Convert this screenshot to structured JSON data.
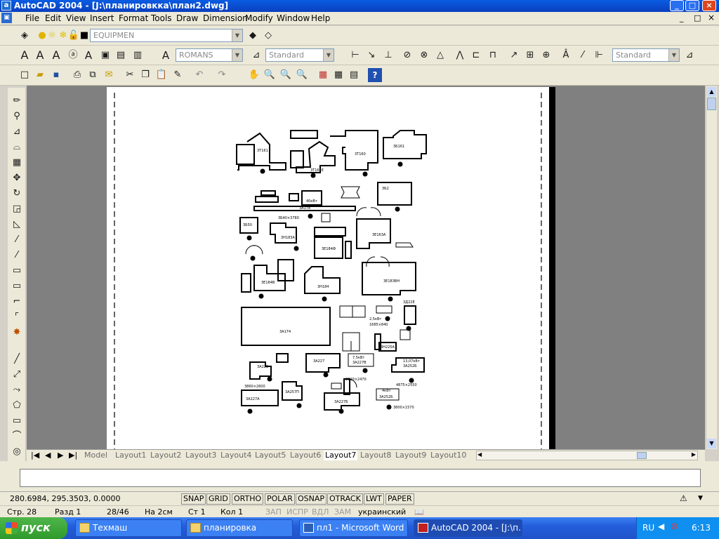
{
  "window": {
    "title": "AutoCAD 2004 - [J:\\планировкка\\план2.dwg]",
    "controls": [
      "_",
      "□",
      "×"
    ],
    "doc_controls": [
      "_",
      "□",
      "×"
    ]
  },
  "menu": [
    "File",
    "Edit",
    "View",
    "Insert",
    "Format",
    "Tools",
    "Draw",
    "Dimension",
    "Modify",
    "Window",
    "Help"
  ],
  "layers_toolbar": {
    "layer_value": "EQUIPMEN"
  },
  "styles_toolbar": {
    "text_style": "ROMANS",
    "dim_style": "Standard",
    "table_style": "Standard"
  },
  "tabs": {
    "items": [
      "Model",
      "Layout1",
      "Layout2",
      "Layout3",
      "Layout4",
      "Layout5",
      "Layout6",
      "Layout7",
      "Layout8",
      "Layout9",
      "Layout10"
    ],
    "active": "Layout7"
  },
  "status": {
    "coords": "280.6984, 295.3503, 0.0000",
    "buttons": [
      "SNAP",
      "GRID",
      "ORTHO",
      "POLAR",
      "OSNAP",
      "OTRACK",
      "LWT",
      "PAPER"
    ]
  },
  "word_status": {
    "page": "Стр. 28",
    "section": "Разд 1",
    "pages": "28/46",
    "at": "На 2см",
    "line": "Ст 1",
    "col": "Кол 1",
    "modes": [
      "ЗАП",
      "ИСПР",
      "ВДЛ",
      "ЗАМ"
    ],
    "language": "украинский"
  },
  "taskbar": {
    "start": "пуск",
    "tasks": [
      "Техмаш",
      "планировка",
      "пл1 - Microsoft Word",
      "AutoCAD 2004 - [J:\\п..."
    ],
    "lang": "RU",
    "clock": "6:13"
  },
  "drawing_labels": {
    "m1": "3Т161",
    "m2": "3Т161Е",
    "m3": "3Т160",
    "m4": "3Б161",
    "m5": "3Б2",
    "m6": "40кВт",
    "m7": "3А178",
    "m8": "3Б50",
    "m9": "3Б40×3780",
    "m10": "3Н183А",
    "m11": "3Е184В",
    "m12": "3Е163А",
    "m13": "3Е184Ф",
    "m14": "3Н184",
    "m15": "3Е183ВН",
    "m16": "3А174",
    "m17": "3Д22Е",
    "m18": "2,5кВт",
    "m19": "1685×840",
    "m20": "3Н225А",
    "m21": "3А228",
    "m22": "3А227",
    "m23": "7,5кВт",
    "m24": "3А227В",
    "m25": "13,07кВт",
    "m26": "3А252Б",
    "m27": "3860×2600",
    "m28": "2320×2470",
    "m29": "4875×2550",
    "m30": "3А227А",
    "m31": "3А257П",
    "m32": "3А227Б",
    "m33": "4кВт",
    "m34": "3А252Б",
    "m35": "3800×1570"
  }
}
